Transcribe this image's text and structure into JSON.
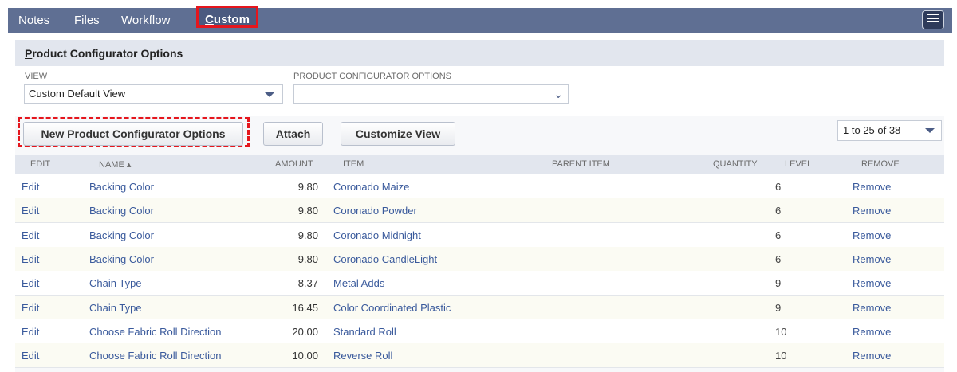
{
  "tabs": [
    {
      "id": "notes",
      "prefix": "",
      "u": "N",
      "rest": "otes"
    },
    {
      "id": "files",
      "prefix": "",
      "u": "F",
      "rest": "iles"
    },
    {
      "id": "workflow",
      "prefix": "",
      "u": "W",
      "rest": "orkflow"
    },
    {
      "id": "custom",
      "prefix": "",
      "u": "C",
      "rest": "ustom"
    }
  ],
  "panel": {
    "title_u": "P",
    "title_rest": "roduct Configurator Options"
  },
  "filters": {
    "view_label": "VIEW",
    "view_value": "Custom Default View",
    "options_label": "PRODUCT CONFIGURATOR OPTIONS",
    "options_value": ""
  },
  "buttons": {
    "new": "New Product Configurator Options",
    "attach": "Attach",
    "customize": "Customize View"
  },
  "pager": "1 to 25 of 38",
  "columns": [
    "EDIT",
    "NAME ▴",
    "AMOUNT",
    "ITEM",
    "PARENT ITEM",
    "QUANTITY",
    "LEVEL",
    "REMOVE"
  ],
  "rows": [
    {
      "edit": "Edit",
      "name": "Backing Color",
      "amount": "9.80",
      "item": "Coronado Maize",
      "parent": "",
      "quantity": "",
      "level": "6",
      "remove": "Remove"
    },
    {
      "edit": "Edit",
      "name": "Backing Color",
      "amount": "9.80",
      "item": "Coronado Powder",
      "parent": "",
      "quantity": "",
      "level": "6",
      "remove": "Remove"
    },
    {
      "edit": "Edit",
      "name": "Backing Color",
      "amount": "9.80",
      "item": "Coronado Midnight",
      "parent": "",
      "quantity": "",
      "level": "6",
      "remove": "Remove"
    },
    {
      "edit": "Edit",
      "name": "Backing Color",
      "amount": "9.80",
      "item": "Coronado CandleLight",
      "parent": "",
      "quantity": "",
      "level": "6",
      "remove": "Remove"
    },
    {
      "edit": "Edit",
      "name": "Chain Type",
      "amount": "8.37",
      "item": "Metal Adds",
      "parent": "",
      "quantity": "",
      "level": "9",
      "remove": "Remove"
    },
    {
      "edit": "Edit",
      "name": "Chain Type",
      "amount": "16.45",
      "item": "Color Coordinated Plastic",
      "parent": "",
      "quantity": "",
      "level": "9",
      "remove": "Remove"
    },
    {
      "edit": "Edit",
      "name": "Choose Fabric Roll Direction",
      "amount": "20.00",
      "item": "Standard Roll",
      "parent": "",
      "quantity": "",
      "level": "10",
      "remove": "Remove"
    },
    {
      "edit": "Edit",
      "name": "Choose Fabric Roll Direction",
      "amount": "10.00",
      "item": "Reverse Roll",
      "parent": "",
      "quantity": "",
      "level": "10",
      "remove": "Remove"
    }
  ]
}
